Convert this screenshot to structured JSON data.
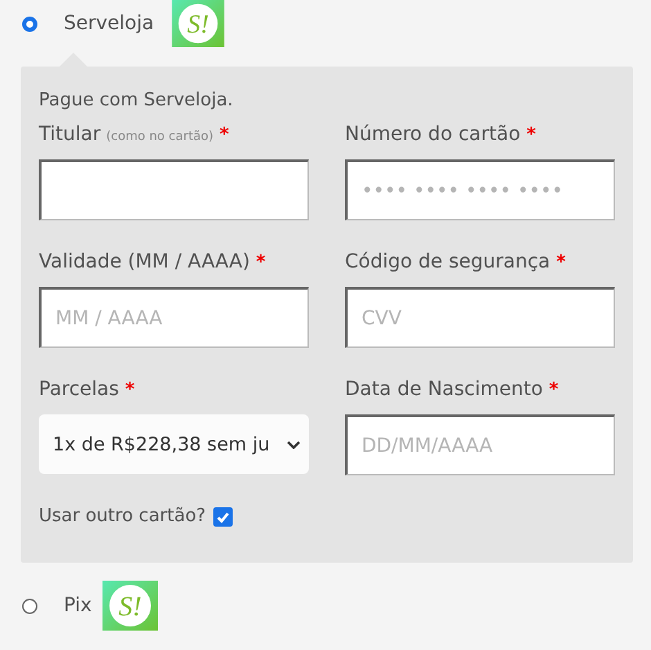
{
  "payment_methods": [
    {
      "label": "Serveloja",
      "selected": true,
      "logo": "S!"
    },
    {
      "label": "Pix",
      "selected": false,
      "logo": "S!"
    }
  ],
  "panel": {
    "intro": "Pague com Serveloja.",
    "fields": [
      {
        "kind": "text",
        "label": "Titular",
        "hint": "(como no cartão)",
        "required_mark": "*"
      },
      {
        "kind": "text",
        "label": "Número do cartão",
        "required_mark": "*",
        "placeholder": "•••• •••• •••• ••••"
      },
      {
        "kind": "text",
        "label": "Validade (MM / AAAA)",
        "required_mark": "*",
        "placeholder": "MM / AAAA"
      },
      {
        "kind": "text",
        "label": "Código de segurança",
        "required_mark": "*",
        "placeholder": "CVV"
      },
      {
        "kind": "select",
        "label": "Parcelas",
        "required_mark": "*",
        "value": "1x de R$228,38 sem ju"
      },
      {
        "kind": "text",
        "label": "Data de Nascimento",
        "required_mark": "*",
        "placeholder": "DD/MM/AAAA"
      }
    ],
    "other_card": {
      "label": "Usar outro cartão?",
      "checked": true
    }
  }
}
